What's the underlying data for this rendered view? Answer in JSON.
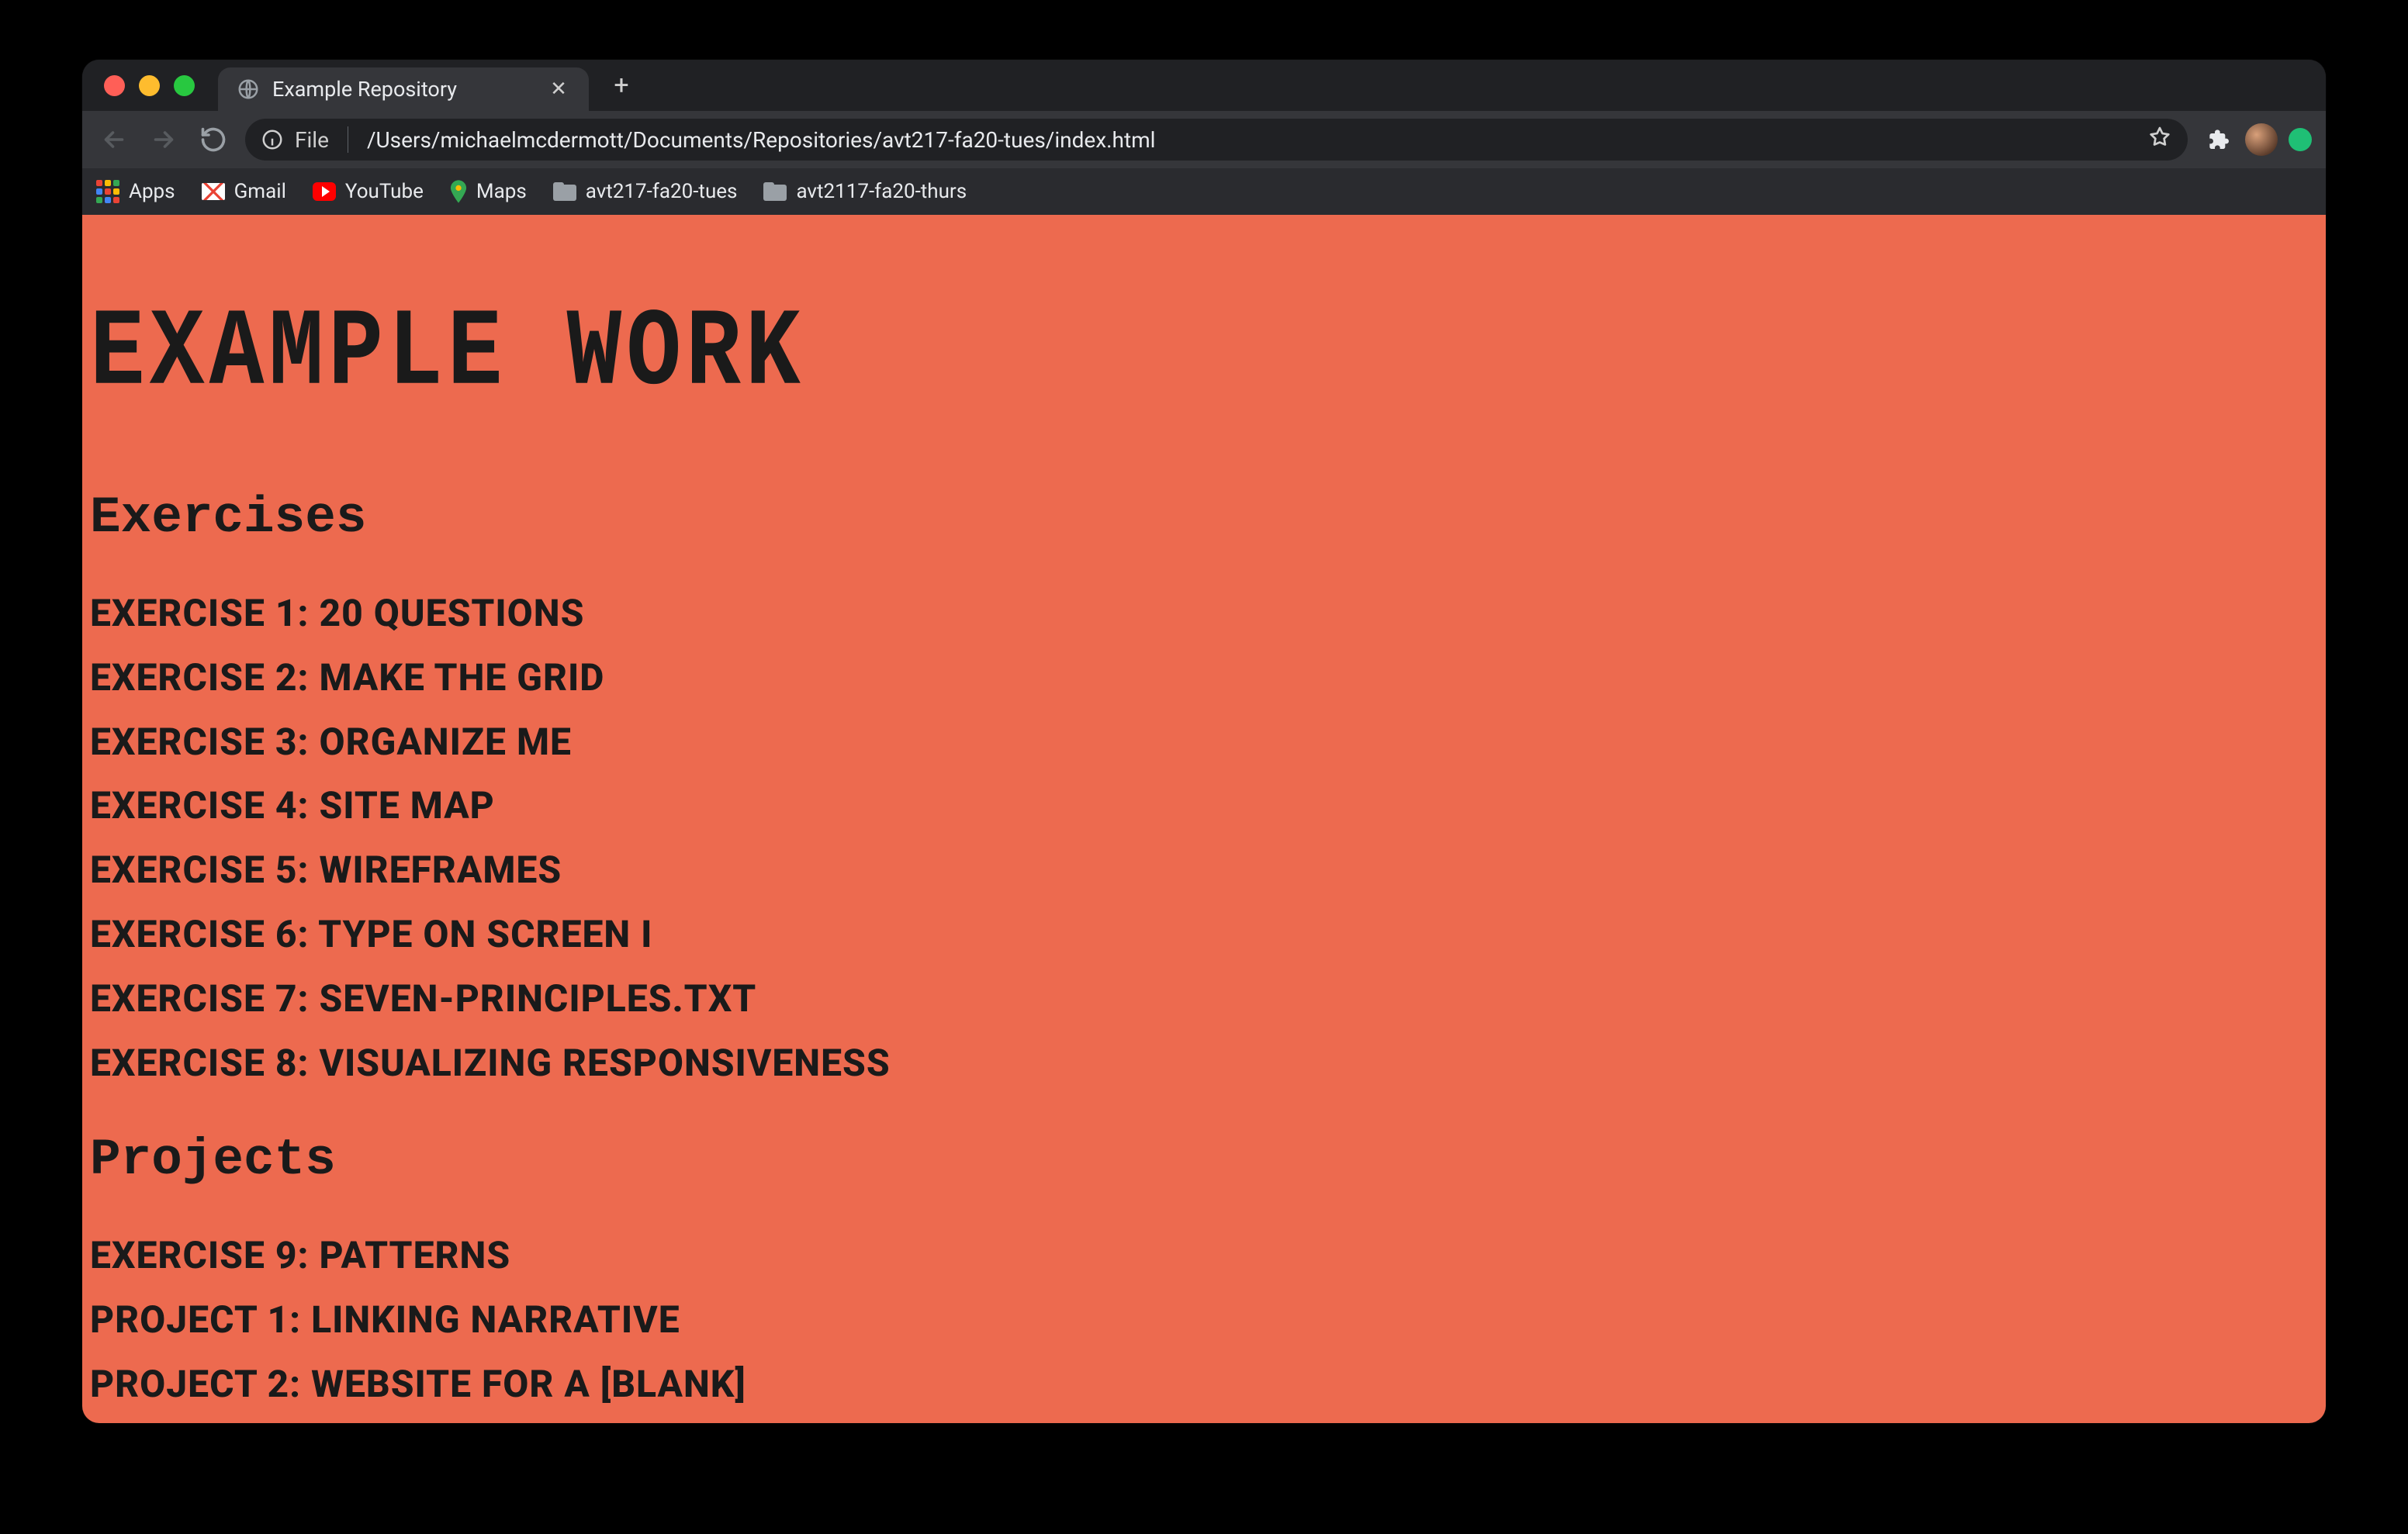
{
  "tab": {
    "title": "Example Repository"
  },
  "omnibox": {
    "scheme_label": "File",
    "path": "/Users/michaelmcdermott/Documents/Repositories/avt217-fa20-tues/index.html"
  },
  "bookmarks": {
    "apps": "Apps",
    "gmail": "Gmail",
    "youtube": "YouTube",
    "maps": "Maps",
    "folder1": "avt217-fa20-tues",
    "folder2": "avt2117-fa20-thurs"
  },
  "page": {
    "title": "EXAMPLE WORK",
    "section_exercises": "Exercises",
    "section_projects": "Projects",
    "exercises": [
      "EXERCISE 1: 20 QUESTIONS",
      "EXERCISE 2: MAKE THE GRID",
      "EXERCISE 3: ORGANIZE ME",
      "EXERCISE 4: SITE MAP",
      "EXERCISE 5: WIREFRAMES",
      "EXERCISE 6: TYPE ON SCREEN I",
      "EXERCISE 7: SEVEN-PRINCIPLES.TXT",
      "EXERCISE 8: VISUALIZING RESPONSIVENESS"
    ],
    "projects": [
      "EXERCISE 9: PATTERNS",
      "PROJECT 1: LINKING NARRATIVE",
      "PROJECT 2: WEBSITE FOR A [BLANK]"
    ]
  }
}
